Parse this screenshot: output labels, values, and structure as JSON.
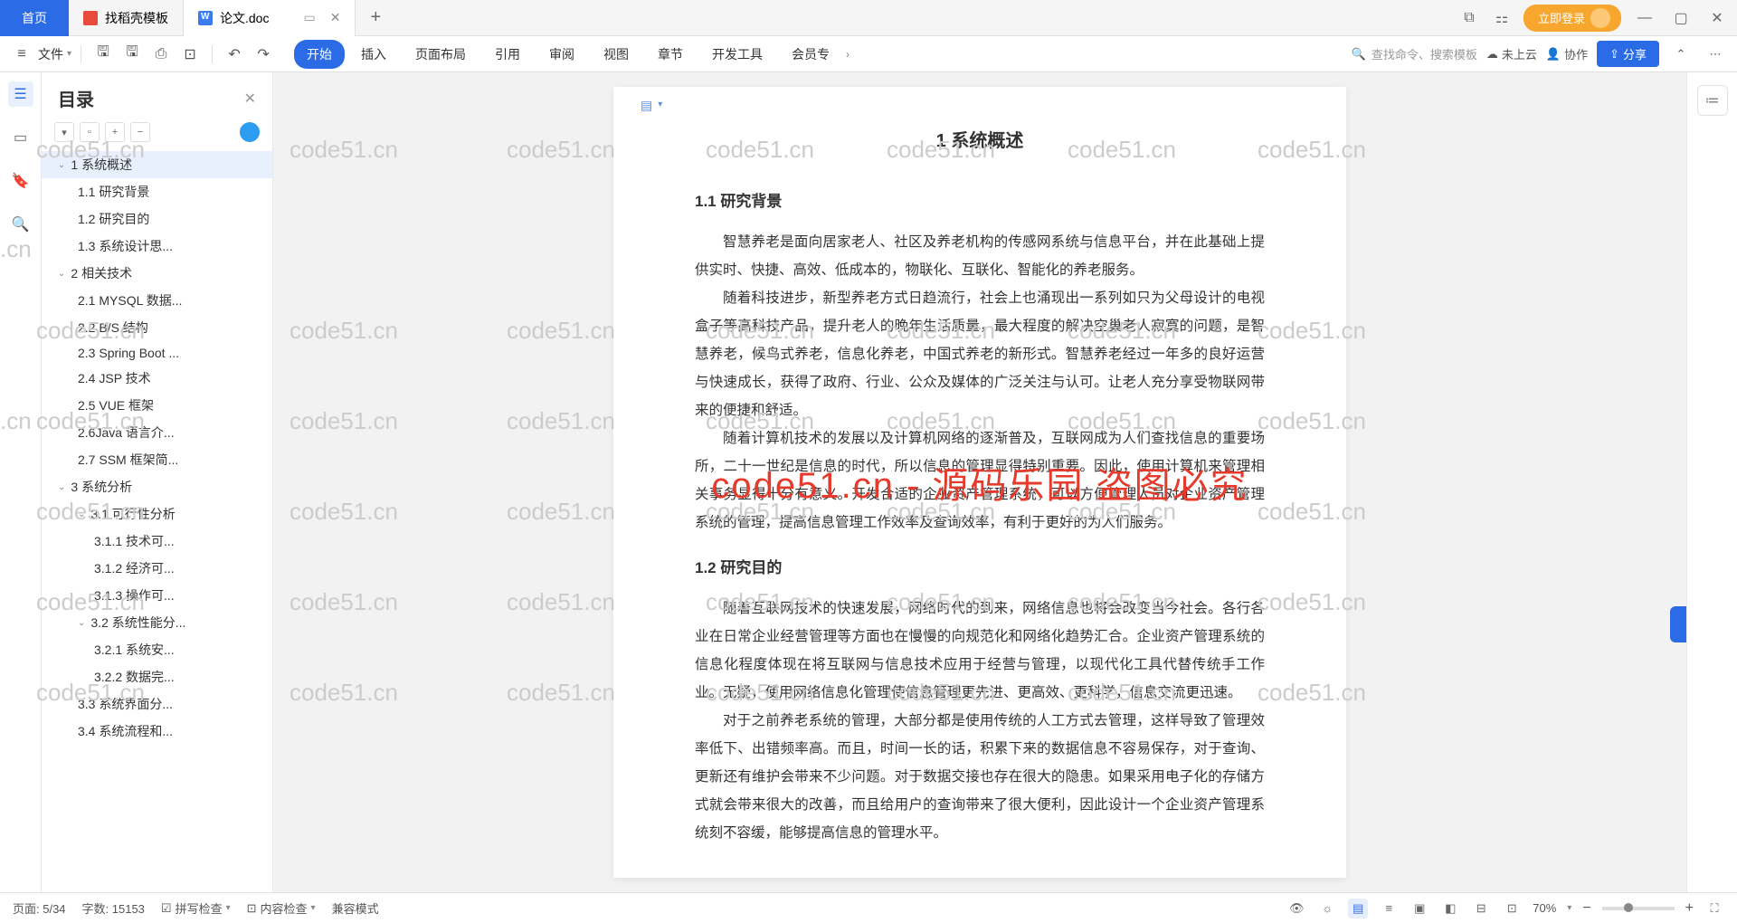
{
  "tabs": {
    "home": "首页",
    "t1": "找稻壳模板",
    "t2": "论文.doc"
  },
  "login": "立即登录",
  "toolbar": {
    "file": "文件"
  },
  "menus": [
    "开始",
    "插入",
    "页面布局",
    "引用",
    "审阅",
    "视图",
    "章节",
    "开发工具",
    "会员专"
  ],
  "search": "查找命令、搜索模板",
  "cloud": "未上云",
  "collab": "协作",
  "share": "分享",
  "outline": {
    "title": "目录",
    "items": [
      {
        "lv": 1,
        "caret": true,
        "label": "1 系统概述",
        "sel": true
      },
      {
        "lv": 2,
        "label": "1.1 研究背景"
      },
      {
        "lv": 2,
        "label": "1.2 研究目的"
      },
      {
        "lv": 2,
        "label": "1.3 系统设计思..."
      },
      {
        "lv": 1,
        "caret": true,
        "label": "2 相关技术"
      },
      {
        "lv": 2,
        "label": "2.1 MYSQL 数据..."
      },
      {
        "lv": 2,
        "label": "2.2 B/S 结构"
      },
      {
        "lv": 2,
        "label": "2.3 Spring Boot ..."
      },
      {
        "lv": 2,
        "label": "2.4 JSP 技术"
      },
      {
        "lv": 2,
        "label": "2.5 VUE 框架"
      },
      {
        "lv": 2,
        "label": "2.6Java 语言介..."
      },
      {
        "lv": 2,
        "label": "2.7 SSM 框架简..."
      },
      {
        "lv": 1,
        "caret": true,
        "label": "3 系统分析"
      },
      {
        "lv": 2,
        "caret": true,
        "label": "3.1 可行性分析"
      },
      {
        "lv": 3,
        "label": "3.1.1 技术可..."
      },
      {
        "lv": 3,
        "label": "3.1.2 经济可..."
      },
      {
        "lv": 3,
        "label": "3.1.3 操作可..."
      },
      {
        "lv": 2,
        "caret": true,
        "label": "3.2 系统性能分..."
      },
      {
        "lv": 3,
        "label": "3.2.1  系统安..."
      },
      {
        "lv": 3,
        "label": "3.2.2  数据完..."
      },
      {
        "lv": 2,
        "label": "3.3 系统界面分..."
      },
      {
        "lv": 2,
        "label": "3.4 系统流程和..."
      }
    ]
  },
  "doc": {
    "h2": "1 系统概述",
    "h3a": "1.1 研究背景",
    "p1": "智慧养老是面向居家老人、社区及养老机构的传感网系统与信息平台，并在此基础上提供实时、快捷、高效、低成本的，物联化、互联化、智能化的养老服务。",
    "p2": "随着科技进步，新型养老方式日趋流行，社会上也涌现出一系列如只为父母设计的电视盒子等高科技产品，提升老人的晚年生活质量，最大程度的解决空巢老人寂寞的问题，是智慧养老，候鸟式养老，信息化养老，中国式养老的新形式。智慧养老经过一年多的良好运营与快速成长，获得了政府、行业、公众及媒体的广泛关注与认可。让老人充分享受物联网带来的便捷和舒适。",
    "p3": "随着计算机技术的发展以及计算机网络的逐渐普及，互联网成为人们查找信息的重要场所，二十一世纪是信息的时代，所以信息的管理显得特别重要。因此，使用计算机来管理相关事务显得十分有意义。开发合适的企业资产管理系统，可以方便管理人员对企业资产管理系统的管理，提高信息管理工作效率及查询效率，有利于更好的为人们服务。",
    "h3b": "1.2 研究目的",
    "p4": "随着互联网技术的快速发展，网络时代的到来，网络信息也将会改变当今社会。各行各业在日常企业经营管理等方面也在慢慢的向规范化和网络化趋势汇合。企业资产管理系统的信息化程度体现在将互联网与信息技术应用于经营与管理，以现代化工具代替传统手工作业。无疑，使用网络信息化管理使信息管理更先进、更高效、更科学，信息交流更迅速。",
    "p5": "对于之前养老系统的管理，大部分都是使用传统的人工方式去管理，这样导致了管理效率低下、出错频率高。而且，时间一长的话，积累下来的数据信息不容易保存，对于查询、更新还有维护会带来不少问题。对于数据交接也存在很大的隐患。如果采用电子化的存储方式就会带来很大的改善，而且给用户的查询带来了很大便利，因此设计一个企业资产管理系统刻不容缓，能够提高信息的管理水平。"
  },
  "watermark_text": "code51.cn",
  "wm_red": "code51.cn - 源码乐园 盗图必究",
  "status": {
    "page": "页面: 5/34",
    "words": "字数: 15153",
    "spell": "拼写检查",
    "content": "内容检查",
    "compat": "兼容模式",
    "zoom": "70%"
  }
}
